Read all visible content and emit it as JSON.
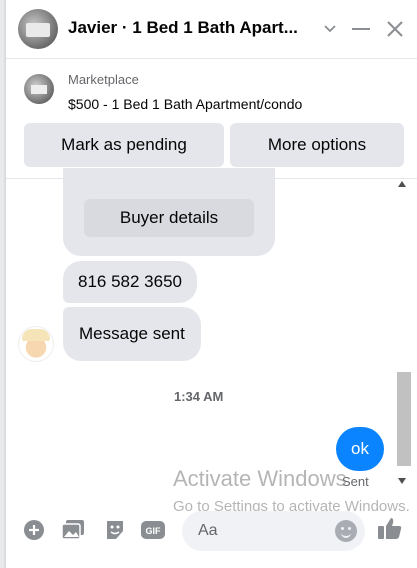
{
  "header": {
    "title": "Javier · 1 Bed 1 Bath Apart...",
    "icons": [
      "chevron-down-icon",
      "minimize-icon",
      "close-icon"
    ]
  },
  "marketplace": {
    "label": "Marketplace",
    "item": "$500 - 1 Bed 1 Bath Apartment/condo",
    "buttons": {
      "pending": "Mark as pending",
      "more": "More options"
    }
  },
  "messages": {
    "buyer_details": "Buyer details",
    "phone": "816 582 3650",
    "status_msg": "Message sent",
    "timestamp": "1:34 AM",
    "outgoing": "ok",
    "sent": "Sent"
  },
  "watermark": {
    "line1": "Activate Windows",
    "line2": "Go to Settings to activate Windows."
  },
  "composer": {
    "placeholder": "Aa",
    "icons": [
      "add-icon",
      "photo-icon",
      "sticker-icon",
      "gif-icon",
      "emoji-icon",
      "like-icon"
    ]
  },
  "colors": {
    "accent": "#0A84FF",
    "bubble": "#E4E6EB",
    "icon": "#8A8D91"
  }
}
